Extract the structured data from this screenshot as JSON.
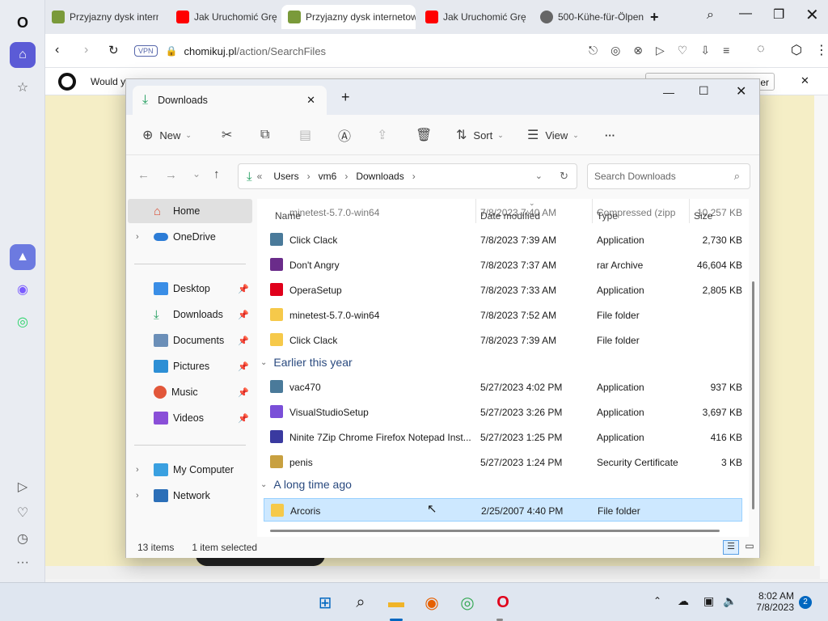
{
  "browser": {
    "tabs": [
      {
        "label": "Przyjazny dysk interne",
        "active": false
      },
      {
        "label": "Jak Uruchomić Grę",
        "active": false
      },
      {
        "label": "Przyjazny dysk internetow",
        "active": true
      },
      {
        "label": "Jak Uruchomić Grę",
        "active": false
      },
      {
        "label": "500-Kühe-für-Ölpen",
        "active": false
      }
    ],
    "vpn_badge": "VPN",
    "url_host": "chomikuj.pl",
    "url_path": "/action/SearchFiles",
    "infobar_text": "Would y",
    "infobar_button": "user"
  },
  "explorer": {
    "tab_title": "Downloads",
    "toolbar": {
      "new_label": "New",
      "sort_label": "Sort",
      "view_label": "View",
      "more_label": "···"
    },
    "breadcrumb": {
      "prefix": "«",
      "parts": [
        "Users",
        "vm6",
        "Downloads"
      ]
    },
    "search_placeholder": "Search Downloads",
    "nav": {
      "home": "Home",
      "onedrive": "OneDrive",
      "desktop": "Desktop",
      "downloads": "Downloads",
      "documents": "Documents",
      "pictures": "Pictures",
      "music": "Music",
      "videos": "Videos",
      "my_computer": "My Computer",
      "network": "Network"
    },
    "columns": {
      "name": "Name",
      "date": "Date modified",
      "type": "Type",
      "size": "Size"
    },
    "partial_row": {
      "name": "minetest-5.7.0-win64",
      "date": "7/8/2023 7:40 AM",
      "type": "Compressed (zipp",
      "size": "10,257 KB"
    },
    "rows_today": [
      {
        "name": "Click Clack",
        "date": "7/8/2023 7:39 AM",
        "type": "Application",
        "size": "2,730 KB",
        "icon": "app-icon"
      },
      {
        "name": "Don't Angry",
        "date": "7/8/2023 7:37 AM",
        "type": "rar Archive",
        "size": "46,604 KB",
        "icon": "rar-icon"
      },
      {
        "name": "OperaSetup",
        "date": "7/8/2023 7:33 AM",
        "type": "Application",
        "size": "2,805 KB",
        "icon": "opera-setup-icon"
      },
      {
        "name": "minetest-5.7.0-win64",
        "date": "7/8/2023 7:52 AM",
        "type": "File folder",
        "size": "",
        "icon": "folder-icon"
      },
      {
        "name": "Click Clack",
        "date": "7/8/2023 7:39 AM",
        "type": "File folder",
        "size": "",
        "icon": "folder-icon"
      }
    ],
    "group_earlier": "Earlier this year",
    "rows_earlier": [
      {
        "name": "vac470",
        "date": "5/27/2023 4:02 PM",
        "type": "Application",
        "size": "937 KB",
        "icon": "app-icon"
      },
      {
        "name": "VisualStudioSetup",
        "date": "5/27/2023 3:26 PM",
        "type": "Application",
        "size": "3,697 KB",
        "icon": "visual-studio-icon"
      },
      {
        "name": "Ninite 7Zip Chrome Firefox Notepad Inst...",
        "date": "5/27/2023 1:25 PM",
        "type": "Application",
        "size": "416 KB",
        "icon": "ninite-icon"
      },
      {
        "name": "penis",
        "date": "5/27/2023 1:24 PM",
        "type": "Security Certificate",
        "size": "3 KB",
        "icon": "certificate-icon"
      }
    ],
    "group_longago": "A long time ago",
    "rows_longago": [
      {
        "name": "Arcoris",
        "date": "2/25/2007 4:40 PM",
        "type": "File folder",
        "size": "",
        "icon": "folder-icon",
        "selected": true
      }
    ],
    "status": {
      "count": "13 items",
      "selection": "1 item selected"
    }
  },
  "taskbar": {
    "time": "8:02 AM",
    "date": "7/8/2023",
    "notif_count": "2"
  },
  "colors": {
    "accent": "#0067c0",
    "folder": "#f6c94a",
    "selection": "#cde8ff",
    "opera_red": "#e0001b"
  }
}
